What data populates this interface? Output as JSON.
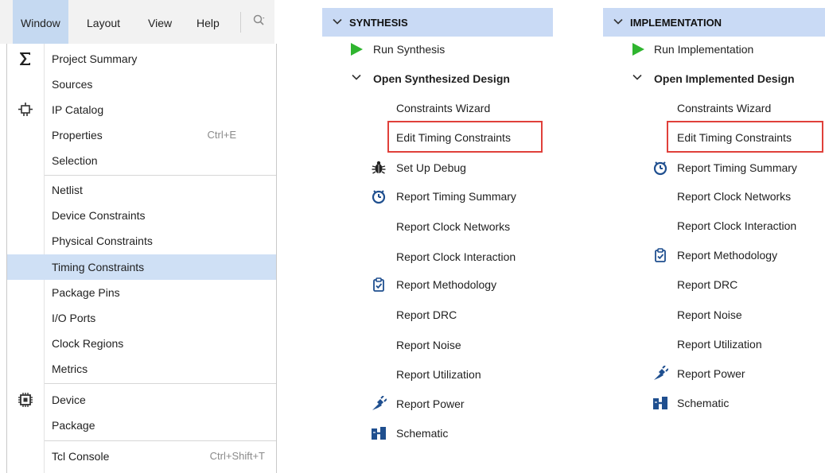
{
  "menubar": {
    "items": [
      "Window",
      "Layout",
      "View",
      "Help"
    ]
  },
  "window_menu": {
    "items": [
      {
        "label": "Project Summary",
        "shortcut": "",
        "icon": "sigma-icon"
      },
      {
        "label": "Sources",
        "shortcut": ""
      },
      {
        "label": "IP Catalog",
        "shortcut": "",
        "icon": "ip-plug-icon"
      },
      {
        "label": "Properties",
        "shortcut": "Ctrl+E"
      },
      {
        "label": "Selection",
        "shortcut": ""
      },
      {
        "label": "Netlist",
        "shortcut": ""
      },
      {
        "label": "Device Constraints",
        "shortcut": ""
      },
      {
        "label": "Physical Constraints",
        "shortcut": ""
      },
      {
        "label": "Timing Constraints",
        "shortcut": "",
        "highlighted": true
      },
      {
        "label": "Package Pins",
        "shortcut": ""
      },
      {
        "label": "I/O Ports",
        "shortcut": ""
      },
      {
        "label": "Clock Regions",
        "shortcut": ""
      },
      {
        "label": "Metrics",
        "shortcut": ""
      },
      {
        "label": "Device",
        "shortcut": "",
        "icon": "chip-icon"
      },
      {
        "label": "Package",
        "shortcut": ""
      },
      {
        "label": "Tcl Console",
        "shortcut": "Ctrl+Shift+T"
      }
    ],
    "highlight_color": "#cfe0f5"
  },
  "synthesis": {
    "title": "SYNTHESIS",
    "run": "Run Synthesis",
    "open": "Open Synthesized Design",
    "items": [
      "Constraints Wizard",
      "Edit Timing Constraints",
      "Set Up Debug",
      "Report Timing Summary",
      "Report Clock Networks",
      "Report Clock Interaction",
      "Report Methodology",
      "Report DRC",
      "Report Noise",
      "Report Utilization",
      "Report Power",
      "Schematic"
    ]
  },
  "implementation": {
    "title": "IMPLEMENTATION",
    "run": "Run Implementation",
    "open": "Open Implemented Design",
    "items": [
      "Constraints Wizard",
      "Edit Timing Constraints",
      "Report Timing Summary",
      "Report Clock Networks",
      "Report Clock Interaction",
      "Report Methodology",
      "Report DRC",
      "Report Noise",
      "Report Utilization",
      "Report Power",
      "Schematic"
    ]
  },
  "colors": {
    "header_bg": "#c9daf5",
    "run_green": "#2fb52f",
    "callout_red": "#e0403a"
  }
}
